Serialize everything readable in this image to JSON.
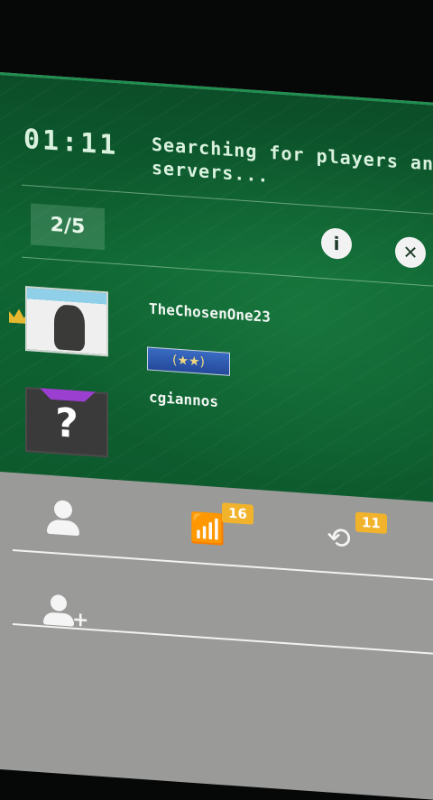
{
  "lobby": {
    "timer": "01:11",
    "status_line1": "Searching for players and",
    "status_line2": "servers...",
    "player_count": "2/5",
    "info_label": "i",
    "close_label": "✕"
  },
  "players": [
    {
      "name": "TheChosenOne23",
      "rank_label": "(★★)",
      "leader": true
    },
    {
      "name": "cgiannos",
      "avatar_label": "?"
    }
  ],
  "bottom_bar": {
    "notifications_count": "16",
    "history_count": "11",
    "signal_glyph": "📶",
    "history_glyph": "⟲"
  },
  "colors": {
    "accent_green": "#0f6633",
    "badge_orange": "#f2b32c",
    "rank_blue": "#3a6cc2"
  }
}
